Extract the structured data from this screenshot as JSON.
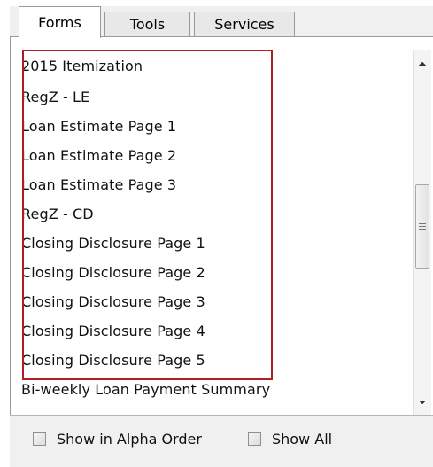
{
  "tabs": [
    {
      "label": "Forms",
      "active": true
    },
    {
      "label": "Tools",
      "active": false
    },
    {
      "label": "Services",
      "active": false
    }
  ],
  "forms_list": {
    "items": [
      "2015 Itemization",
      "RegZ - LE",
      "Loan Estimate Page 1",
      "Loan Estimate Page 2",
      "Loan Estimate Page 3",
      "RegZ - CD",
      "Closing Disclosure Page 1",
      "Closing Disclosure Page 2",
      "Closing Disclosure Page 3",
      "Closing Disclosure Page 4",
      "Closing Disclosure Page 5",
      "Bi-weekly Loan Payment Summary"
    ],
    "highlighted_range": [
      0,
      10
    ],
    "highlight_color": "#b01e23"
  },
  "options": {
    "alpha_order_label": "Show in Alpha Order",
    "alpha_order_checked": false,
    "show_all_label": "Show All",
    "show_all_checked": false
  },
  "icons": {
    "scroll_up": "chevron-up-icon",
    "scroll_down": "chevron-down-icon",
    "scroll_grip": "grip-icon"
  }
}
